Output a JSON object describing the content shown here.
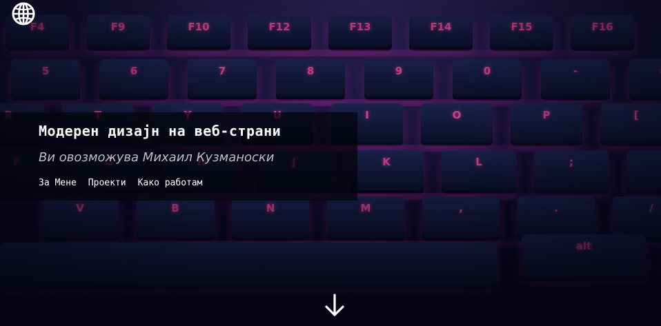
{
  "header": {
    "globe_icon": "globe-icon"
  },
  "hero": {
    "title": "Модерен дизајн на веб-страни",
    "subtitle": "Ви овозможува Михаил Кузманоски"
  },
  "nav": {
    "items": [
      {
        "label": "За Мене"
      },
      {
        "label": "Проекти"
      },
      {
        "label": "Како работам"
      }
    ]
  },
  "scroll": {
    "icon": "arrow-down-icon"
  },
  "background": {
    "keys_row_1": [
      "F4",
      "F9",
      "F10",
      "F12",
      "F13",
      "F14",
      "F15",
      "F16"
    ],
    "keys_row_2": [
      "5",
      "6",
      "7",
      "8",
      "9",
      "0",
      "-",
      "="
    ],
    "keys_row_3": [
      "R",
      "T",
      "Y",
      "U",
      "I",
      "O",
      "P",
      "["
    ],
    "keys_row_4": [
      "F",
      "G",
      "H",
      "J",
      "K",
      "L",
      ";",
      "'"
    ],
    "keys_row_5": [
      "V",
      "B",
      "N",
      "M",
      ",",
      ".",
      "/"
    ],
    "key_alt": "alt",
    "colors": {
      "key_glow": "#e0488f",
      "key_face": "#1c2550",
      "backdrop": "#07071a"
    }
  }
}
